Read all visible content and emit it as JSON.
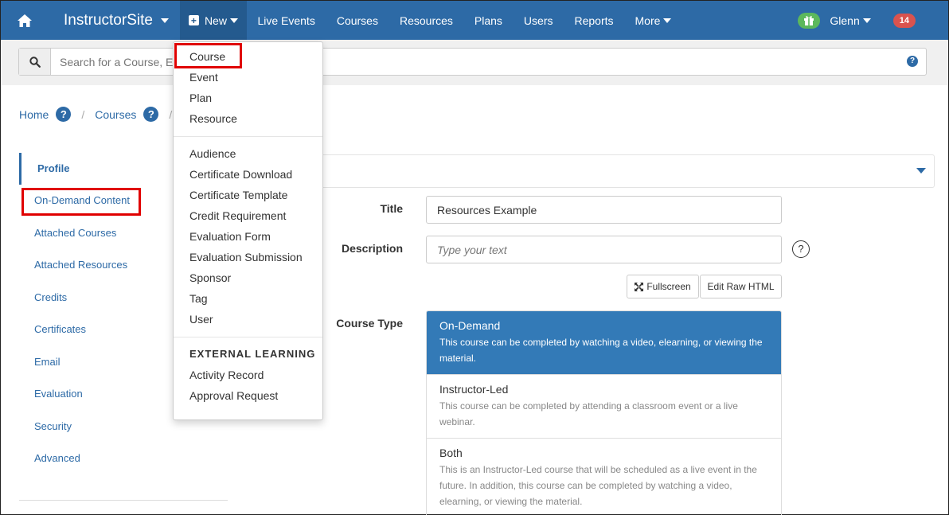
{
  "nav": {
    "brand": "InstructorSite",
    "new_label": "New",
    "items": [
      "Live Events",
      "Courses",
      "Resources",
      "Plans",
      "Users",
      "Reports"
    ],
    "more_label": "More",
    "user_name": "Glenn",
    "notification_count": "14"
  },
  "search": {
    "placeholder": "Search for a Course, Event, Plan, Resource, or User",
    "help": "?"
  },
  "breadcrumb": {
    "home": "Home",
    "courses": "Courses",
    "help": "?",
    "sep": "/"
  },
  "sidebar": {
    "items": [
      "Profile",
      "On-Demand Content",
      "Attached Courses",
      "Attached Resources",
      "Credits",
      "Certificates",
      "Email",
      "Evaluation",
      "Security",
      "Advanced"
    ]
  },
  "form": {
    "title_label": "Title",
    "title_value": "Resources Example",
    "description_label": "Description",
    "description_placeholder": "Type your text",
    "description_help": "?",
    "fullscreen_label": "Fullscreen",
    "edit_raw_label": "Edit Raw HTML",
    "course_type_label": "Course Type",
    "course_types": [
      {
        "title": "On-Demand",
        "desc": "This course can be completed by watching a video, elearning, or viewing the material.",
        "selected": true
      },
      {
        "title": "Instructor-Led",
        "desc": "This course can be completed by attending a classroom event or a live webinar.",
        "selected": false
      },
      {
        "title": "Both",
        "desc": "This is an Instructor-Led course that will be scheduled as a live event in the future. In addition, this course can be completed by watching a video, elearning, or viewing the material.",
        "selected": false
      }
    ]
  },
  "dropdown": {
    "group1": [
      "Course",
      "Event",
      "Plan",
      "Resource"
    ],
    "group2": [
      "Audience",
      "Certificate Download",
      "Certificate Template",
      "Credit Requirement",
      "Evaluation Form",
      "Evaluation Submission",
      "Sponsor",
      "Tag",
      "User"
    ],
    "external_header": "EXTERNAL LEARNING",
    "group3": [
      "Activity Record",
      "Approval Request"
    ]
  },
  "colors": {
    "nav_bg": "#2d6aa6",
    "accent": "#337ab7",
    "highlight": "#e00000",
    "badge": "#d9534f",
    "gift": "#5cb85c"
  }
}
